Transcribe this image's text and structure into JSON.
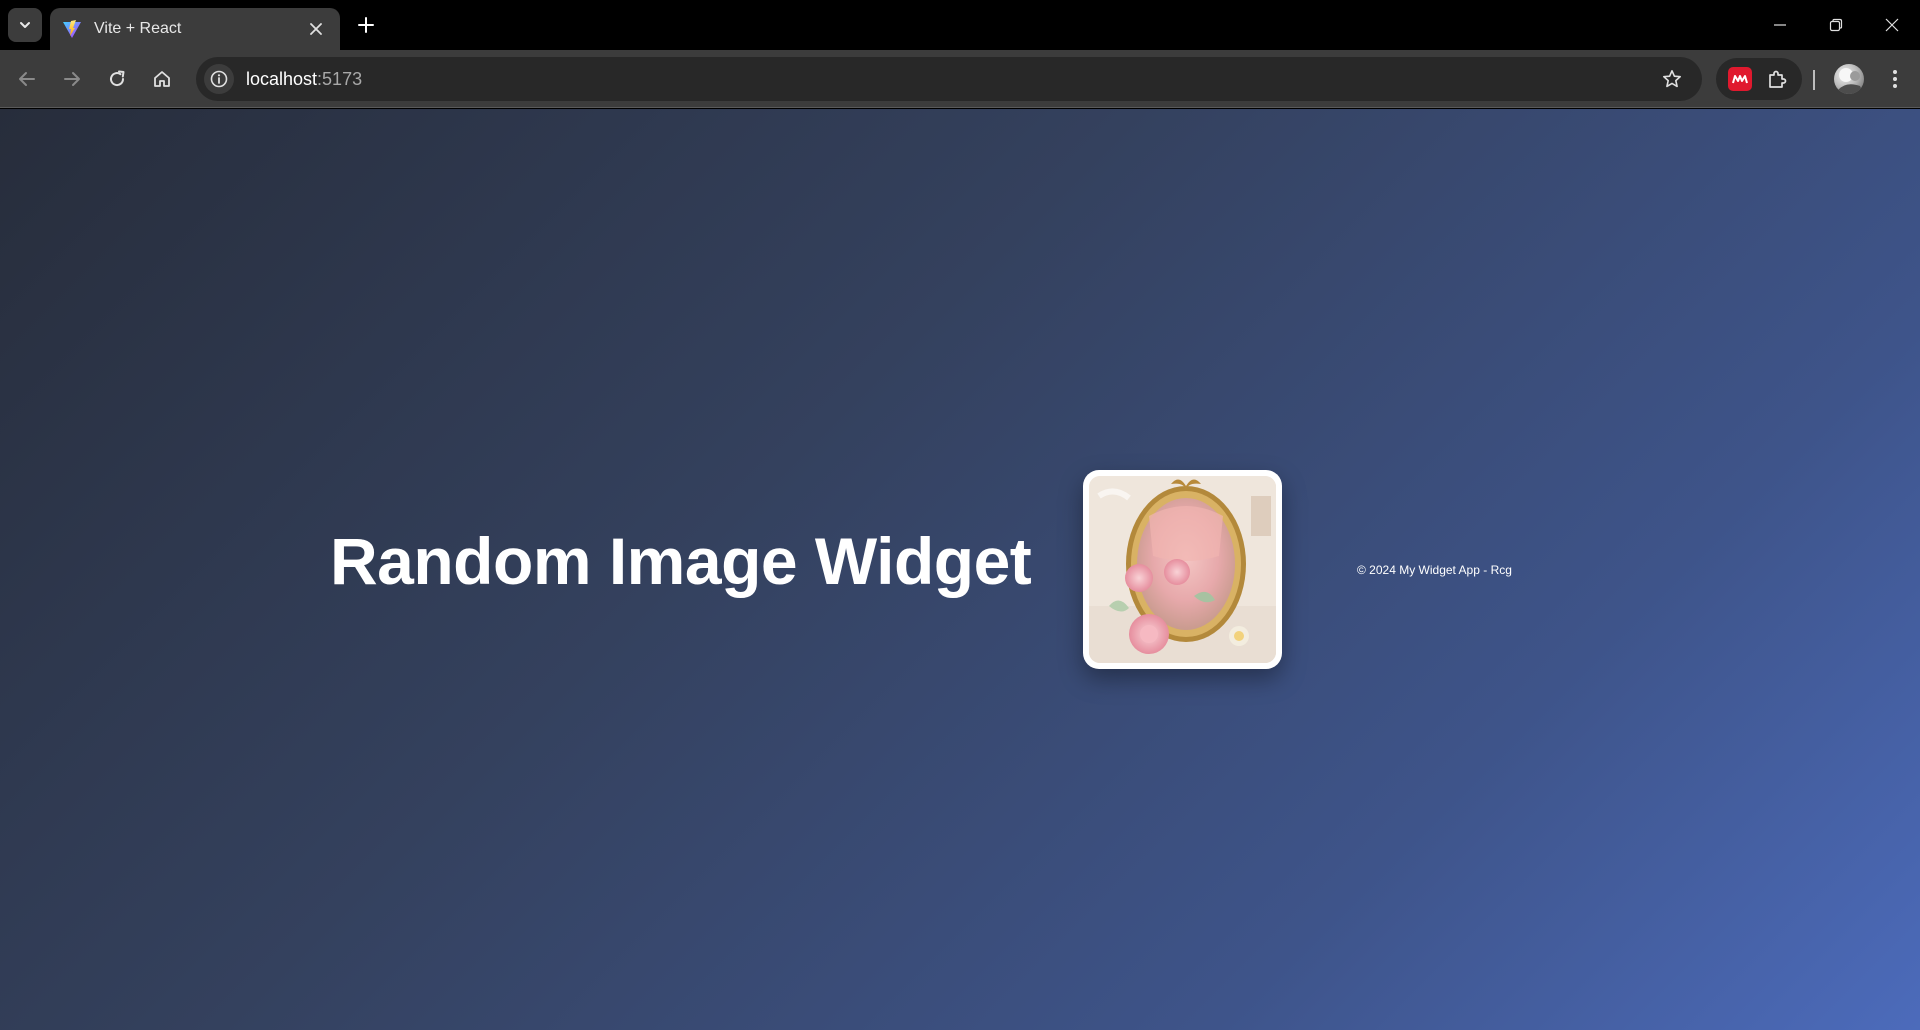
{
  "browser": {
    "tab": {
      "title": "Vite + React"
    },
    "address_bar": {
      "host": "localhost",
      "port": ":5173"
    }
  },
  "page": {
    "heading": "Random Image Widget",
    "footer": "© 2024 My Widget App - Rcg",
    "image_description_icon": "mirror-photo"
  },
  "colors": {
    "background_start": "#272d3b",
    "background_end": "#4c6bbb",
    "card_border": "#ffffff",
    "extension_red": "#e0192e"
  }
}
